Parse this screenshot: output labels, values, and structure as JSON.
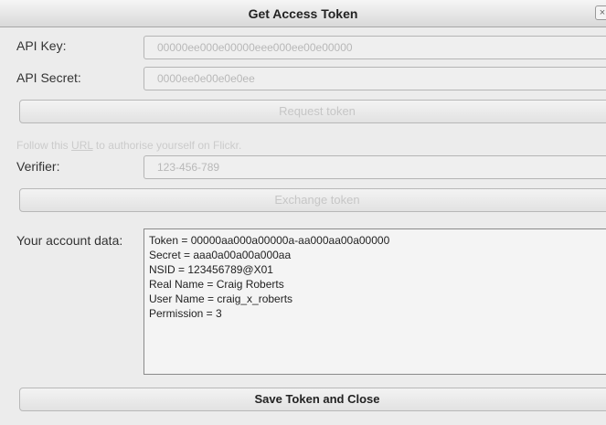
{
  "window": {
    "title": "Get Access Token",
    "close_glyph": "×"
  },
  "fields": {
    "api_key": {
      "label": "API Key:",
      "value": "00000ee000e00000eee000ee00e00000"
    },
    "api_secret": {
      "label": "API Secret:",
      "value": "0000ee0e00e0e0ee"
    },
    "verifier": {
      "label": "Verifier:",
      "value": "123-456-789"
    }
  },
  "buttons": {
    "request_token": "Request token",
    "exchange_token": "Exchange token",
    "save_close": "Save Token and Close"
  },
  "hint": {
    "before": "Follow this ",
    "link": "URL",
    "after": " to authorise yourself on Flickr."
  },
  "account": {
    "label": "Your account data:",
    "lines": [
      "Token = 00000aa000a00000a-aa000aa00a00000",
      "Secret = aaa0a00a00a000aa",
      "NSID = 123456789@X01",
      "Real Name = Craig Roberts",
      "User Name = craig_x_roberts",
      "Permission = 3"
    ]
  }
}
